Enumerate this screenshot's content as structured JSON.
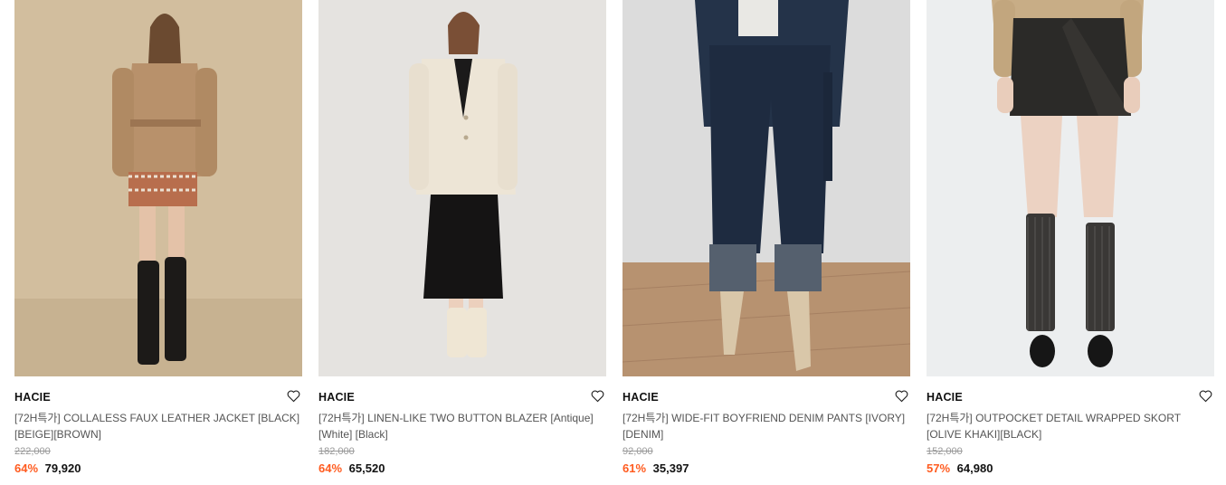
{
  "colors": {
    "discount": "#ff5b1f",
    "original_price": "#999999",
    "title": "#555555"
  },
  "products": [
    {
      "image_alt": "Model wearing beige faux leather belted jacket with houndstooth skirt and black boots",
      "brand": "HACIE",
      "title": "[72H특가] COLLALESS FAUX LEATHER JACKET [BLACK][BEIGE][BROWN]",
      "original_price": "222,000",
      "discount": "64%",
      "price": "79,920",
      "icon": "heart-outline-icon"
    },
    {
      "image_alt": "Model wearing antique white linen two button blazer and black midi skirt",
      "brand": "HACIE",
      "title": "[72H특가] LINEN-LIKE TWO BUTTON BLAZER [Antique][White] [Black]",
      "original_price": "182,000",
      "discount": "64%",
      "price": "65,520",
      "icon": "heart-outline-icon"
    },
    {
      "image_alt": "Model wearing dark denim wide-fit boyfriend pants with cuffs and beige boots",
      "brand": "HACIE",
      "title": "[72H특가] WIDE-FIT BOYFRIEND DENIM PANTS [IVORY][DENIM]",
      "original_price": "92,000",
      "discount": "61%",
      "price": "35,397",
      "icon": "heart-outline-icon"
    },
    {
      "image_alt": "Model wearing olive khaki wrapped skort with knee socks and mary jane shoes",
      "brand": "HACIE",
      "title": "[72H특가] OUTPOCKET DETAIL WRAPPED SKORT [OLIVE KHAKI][BLACK]",
      "original_price": "152,000",
      "discount": "57%",
      "price": "64,980",
      "icon": "heart-outline-icon"
    }
  ]
}
